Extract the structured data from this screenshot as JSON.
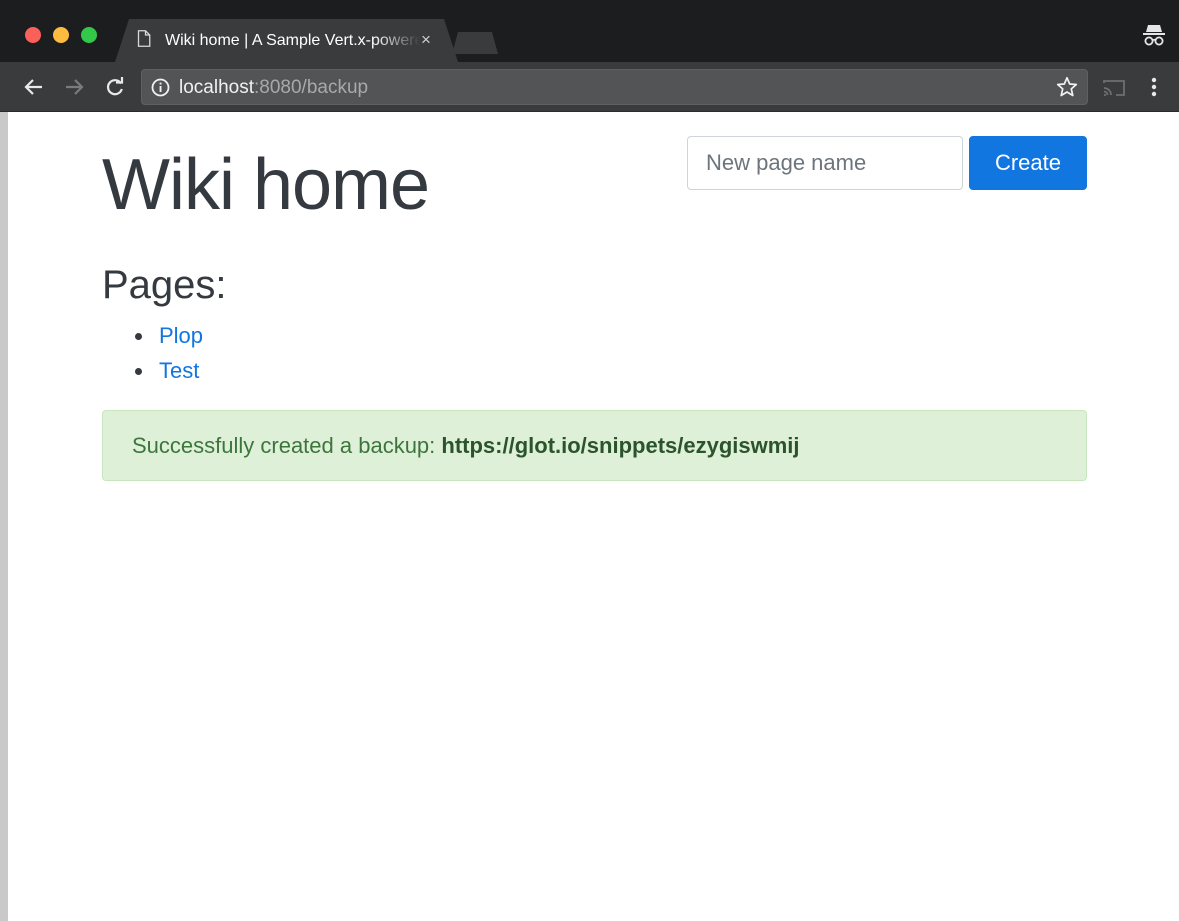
{
  "browser": {
    "tab_title": "Wiki home | A Sample Vert.x-powered Wiki",
    "tab_close_glyph": "×",
    "address": {
      "host": "localhost",
      "path": ":8080/backup"
    }
  },
  "page": {
    "title": "Wiki home",
    "new_page": {
      "placeholder": "New page name",
      "value": "",
      "create_label": "Create"
    },
    "pages_heading": "Pages:",
    "pages": [
      {
        "label": "Plop"
      },
      {
        "label": "Test"
      }
    ],
    "alert": {
      "message": "Successfully created a backup: ",
      "link": "https://glot.io/snippets/ezygiswmij"
    }
  },
  "colors": {
    "accent": "#1176e0",
    "alert_bg": "#dff0d8",
    "alert_text": "#3c763d",
    "heading_text": "#343a40"
  },
  "icons": {
    "tab": "file-icon",
    "back": "arrow-left-icon",
    "forward": "arrow-right-icon",
    "reload": "reload-icon",
    "site_info": "info-icon",
    "bookmark": "star-icon",
    "cast": "cast-icon",
    "menu": "more-vert-icon",
    "profile": "incognito-icon"
  }
}
